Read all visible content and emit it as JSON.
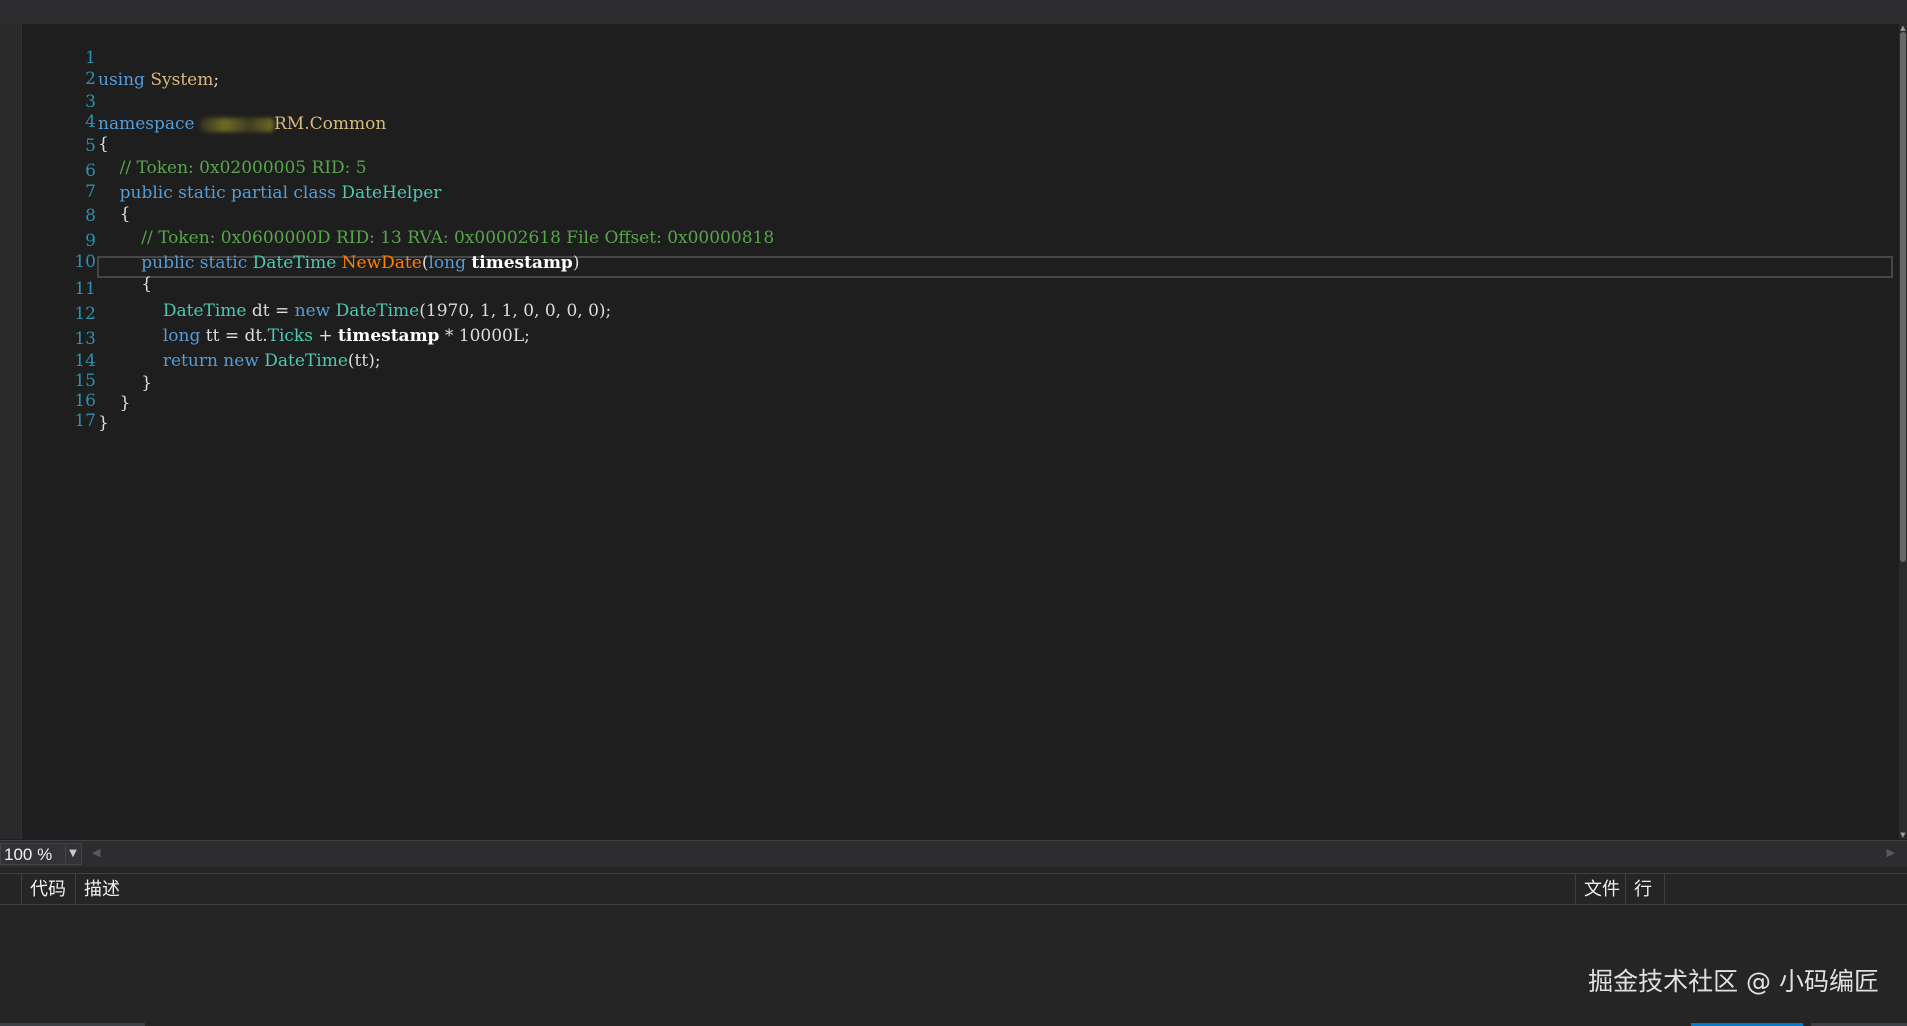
{
  "top_strip": {
    "fragment_a": "",
    "fragment_b": ""
  },
  "editor": {
    "lines": [
      {
        "n": "1"
      },
      {
        "n": "2"
      },
      {
        "n": "3"
      },
      {
        "n": "4"
      },
      {
        "n": "5"
      },
      {
        "n": "6"
      },
      {
        "n": "7"
      },
      {
        "n": "8"
      },
      {
        "n": "9"
      },
      {
        "n": "10"
      },
      {
        "n": "11"
      },
      {
        "n": "12"
      },
      {
        "n": "13"
      },
      {
        "n": "14"
      },
      {
        "n": "15"
      },
      {
        "n": "16"
      },
      {
        "n": "17"
      }
    ],
    "tokens": {
      "l1_kw": "using",
      "l1_ns": "System",
      "l1_semi": ";",
      "l3_kw": "namespace",
      "l3_ns": "RM.Common",
      "l4": "{",
      "l5_cm": "// Token: 0x02000005 RID: 5",
      "l6_kw": "public static partial class",
      "l6_ty": "DateHelper",
      "l7": "{",
      "l8_cm": "// Token: 0x0600000D RID: 13 RVA: 0x00002618 File Offset: 0x00000818",
      "l9_kw": "public static",
      "l9_ty": "DateTime",
      "l9_fn": "NewDate",
      "l9_p1": "(",
      "l9_kw2": "long",
      "l9_pm": "timestamp",
      "l9_p2": ")",
      "l10": "{",
      "l11_ty": "DateTime",
      "l11_a": " dt = ",
      "l11_kw": "new",
      "l11_ty2": "DateTime",
      "l11_b": "(1970, 1, 1, 0, 0, 0, 0);",
      "l12_kw": "long",
      "l12_a": " tt = dt.",
      "l12_ty": "Ticks",
      "l12_b": " + ",
      "l12_pm": "timestamp",
      "l12_c": " * 10000L;",
      "l13_kw": "return new",
      "l13_ty": "DateTime",
      "l13_a": "(tt);",
      "l14": "}",
      "l15": "}",
      "l16": "}"
    }
  },
  "zoom": {
    "value": "100 %"
  },
  "error_list": {
    "columns": {
      "code": "代码",
      "description": "描述",
      "file": "文件",
      "line": "行"
    }
  },
  "watermark": "掘金技术社区 @ 小码编匠",
  "colors": {
    "keyword": "#569cd6",
    "type": "#4ec9b0",
    "comment": "#57a64a",
    "namespace": "#d7ba7d",
    "method": "#ff8000",
    "line_number": "#2b91af"
  }
}
